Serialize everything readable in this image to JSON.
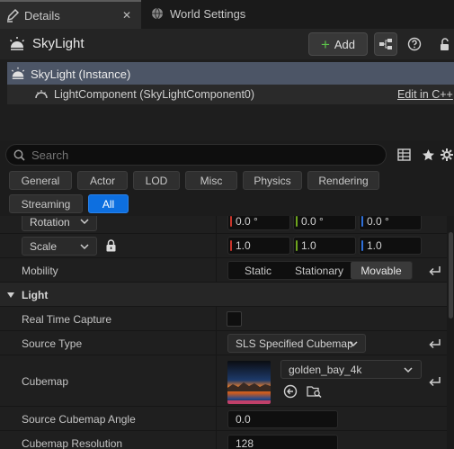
{
  "tabs": [
    {
      "label": "Details",
      "close": "✕"
    },
    {
      "label": "World Settings"
    }
  ],
  "header": {
    "title": "SkyLight",
    "add_label": "Add"
  },
  "tree": {
    "selected": "SkyLight (Instance)",
    "component": "LightComponent (SkyLightComponent0)",
    "edit_link": "Edit in C++"
  },
  "search": {
    "placeholder": "Search"
  },
  "filters": [
    "General",
    "Actor",
    "LOD",
    "Misc",
    "Physics",
    "Rendering",
    "Streaming",
    "All"
  ],
  "filter_active": "All",
  "transform": {
    "rotation_label": "Rotation",
    "rotation": [
      "0.0 °",
      "0.0 °",
      "0.0 °"
    ],
    "scale_label": "Scale",
    "scale": [
      "1.0",
      "1.0",
      "1.0"
    ]
  },
  "mobility": {
    "label": "Mobility",
    "options": [
      "Static",
      "Stationary",
      "Movable"
    ],
    "selected": "Movable"
  },
  "light_section": {
    "title": "Light",
    "real_time_capture_label": "Real Time Capture",
    "real_time_capture": false,
    "source_type_label": "Source Type",
    "source_type": "SLS Specified Cubemap",
    "cubemap_label": "Cubemap",
    "cubemap_asset": "golden_bay_4k",
    "source_cubemap_angle_label": "Source Cubemap Angle",
    "source_cubemap_angle": "0.0",
    "cubemap_resolution_label": "Cubemap Resolution",
    "cubemap_resolution": "128"
  },
  "colors": {
    "accent": "#0d6fe0",
    "selection": "#4c5566",
    "axis_x": "#c8352b",
    "axis_y": "#6ea51d",
    "axis_z": "#2e6fd8"
  }
}
